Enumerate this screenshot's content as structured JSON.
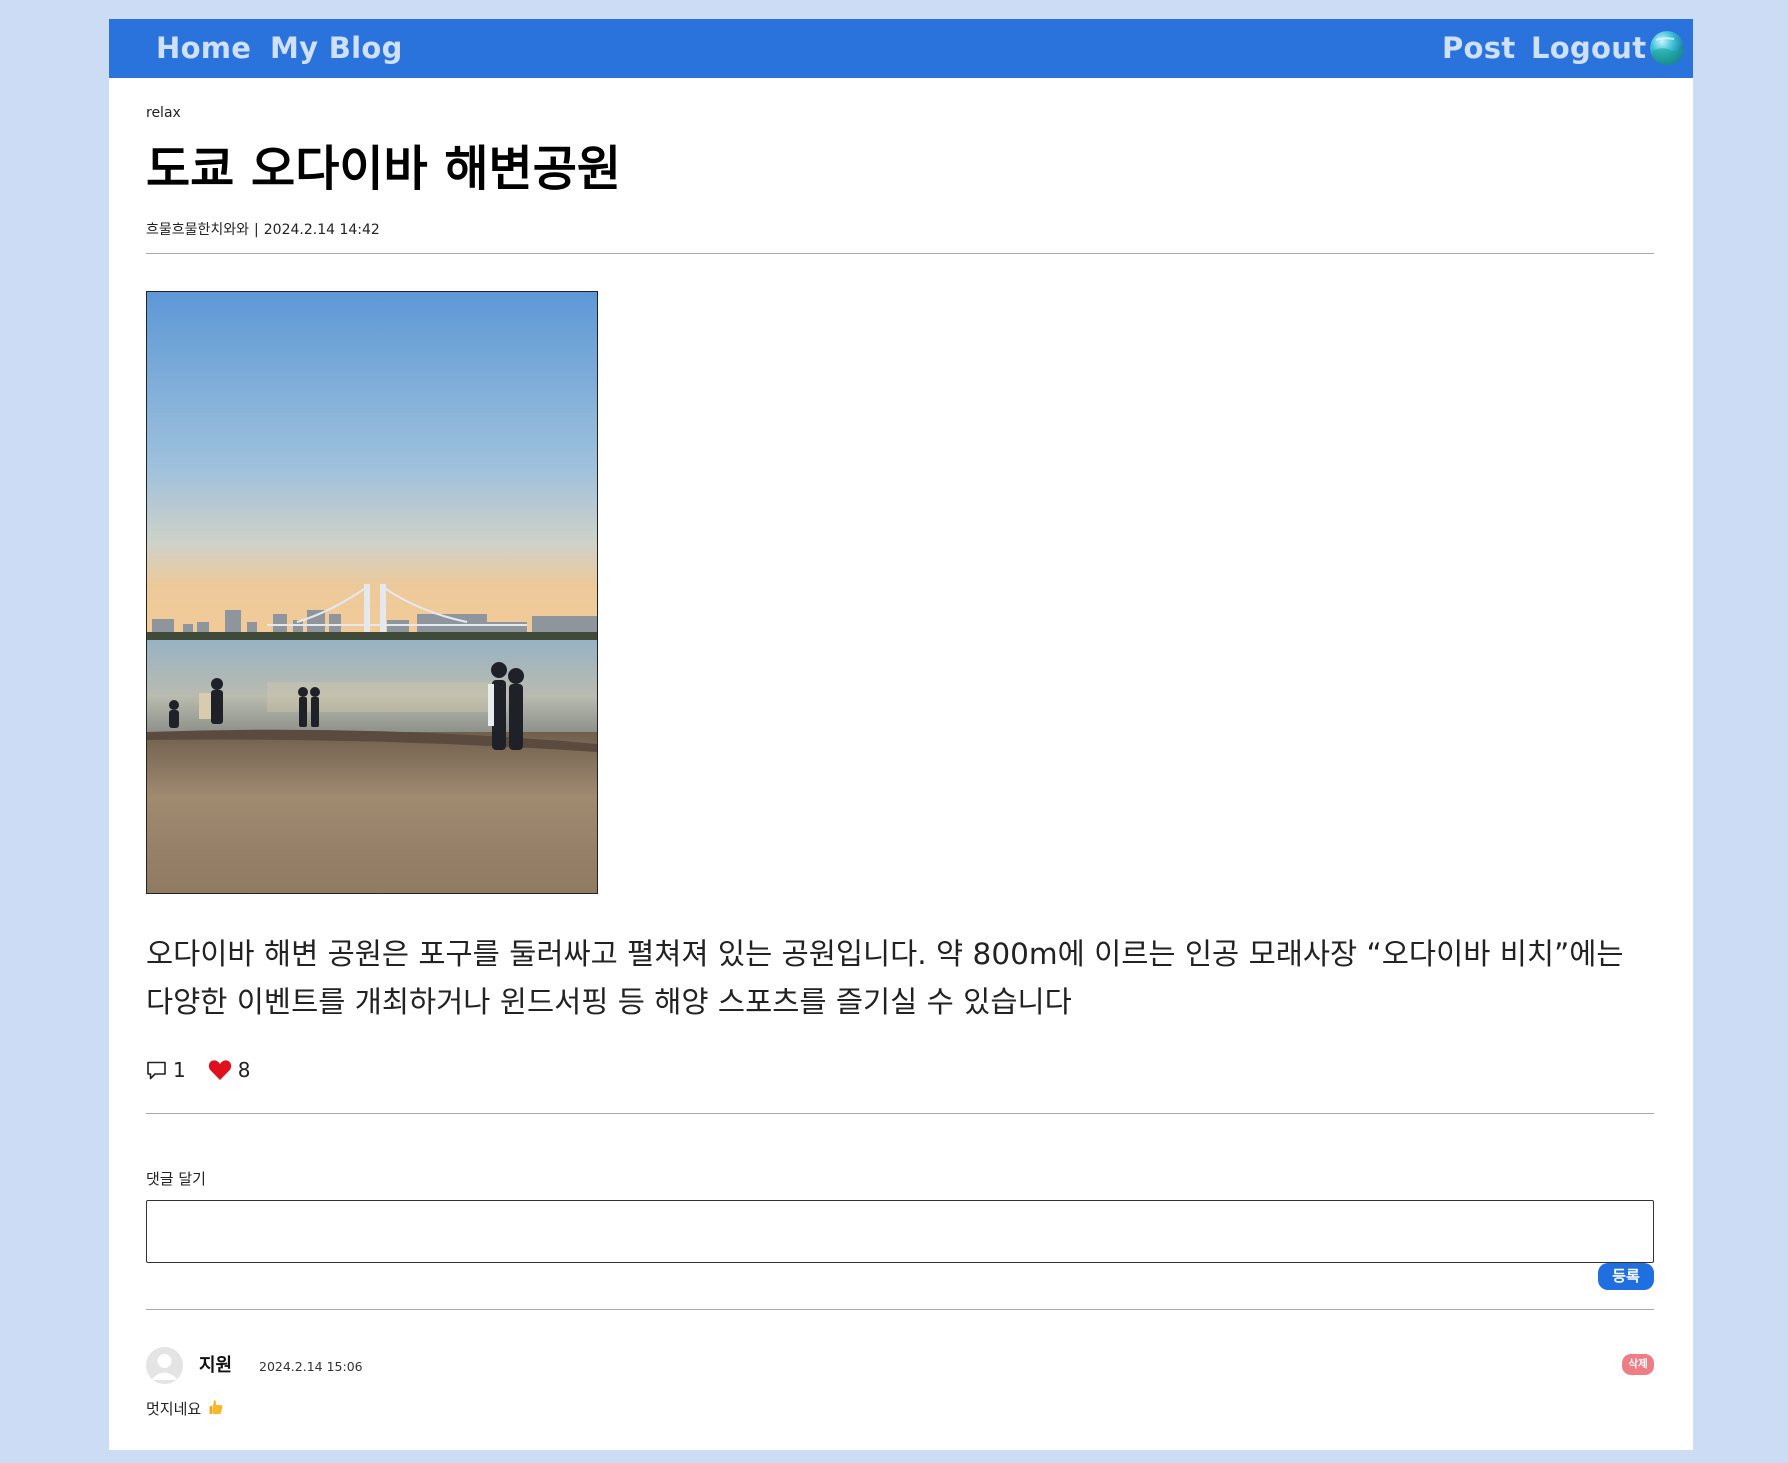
{
  "nav": {
    "home_label": "Home",
    "myblog_label": "My Blog",
    "post_label": "Post",
    "logout_label": "Logout",
    "avatar_icon": "profile-globe-icon"
  },
  "post": {
    "category": "relax",
    "title": "도쿄 오다이바 해변공원",
    "author": "흐물흐물한치와와",
    "separator": "|",
    "date": "2024.2.14 14:42",
    "image_icon": "beach-photo",
    "body": "오다이바 해변 공원은 포구를 둘러싸고 펼쳐져 있는 공원입니다. 약 800m에 이르는 인공 모래사장 “오다이바 비치”에는 다양한 이벤트를 개최하거나 윈드서핑 등 해양 스포츠를 즐기실 수 있습니다",
    "comment_count": "1",
    "like_count": "8"
  },
  "comment_form": {
    "label": "댓글 달기",
    "input_value": "",
    "submit_label": "등록"
  },
  "comments": [
    {
      "author": "지원",
      "date": "2024.2.14 15:06",
      "text": "멋지네요",
      "emoji": "thumbs-up-icon",
      "delete_label": "삭제"
    }
  ],
  "colors": {
    "background": "#cddcf5",
    "navbar": "#2b73dc",
    "nav_text": "#cfe0fb",
    "submit_button": "#1f6fe0",
    "delete_button": "#ee7d86",
    "like_heart": "#e0101c"
  }
}
